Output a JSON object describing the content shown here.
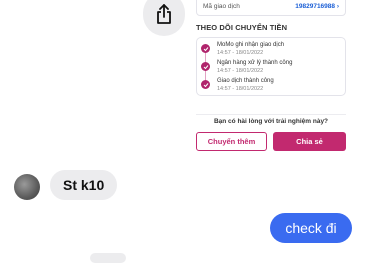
{
  "share": {
    "icon": "share-icon"
  },
  "receipt": {
    "code_label": "Mã giao dịch",
    "code_value": "19829716988",
    "code_chevron": "›",
    "track_title": "THEO DÕI CHUYỂN TIỀN",
    "steps": [
      {
        "title": "MoMo ghi nhận giao dịch",
        "time": "14:57 - 18/01/2022"
      },
      {
        "title": "Ngân hàng xử lý thành công",
        "time": "14:57 - 18/01/2022"
      },
      {
        "title": "Giao dịch thành công",
        "time": "14:57 - 18/01/2022"
      }
    ],
    "feedback": "Bạn có hài lòng với trải nghiệm này?",
    "btn_more": "Chuyển thêm",
    "btn_share": "Chia sẻ",
    "accent": "#c2296f"
  },
  "chat": {
    "incoming_text": "St k10",
    "outgoing_text": "check đi",
    "outgoing_color": "#3a6bf0"
  }
}
